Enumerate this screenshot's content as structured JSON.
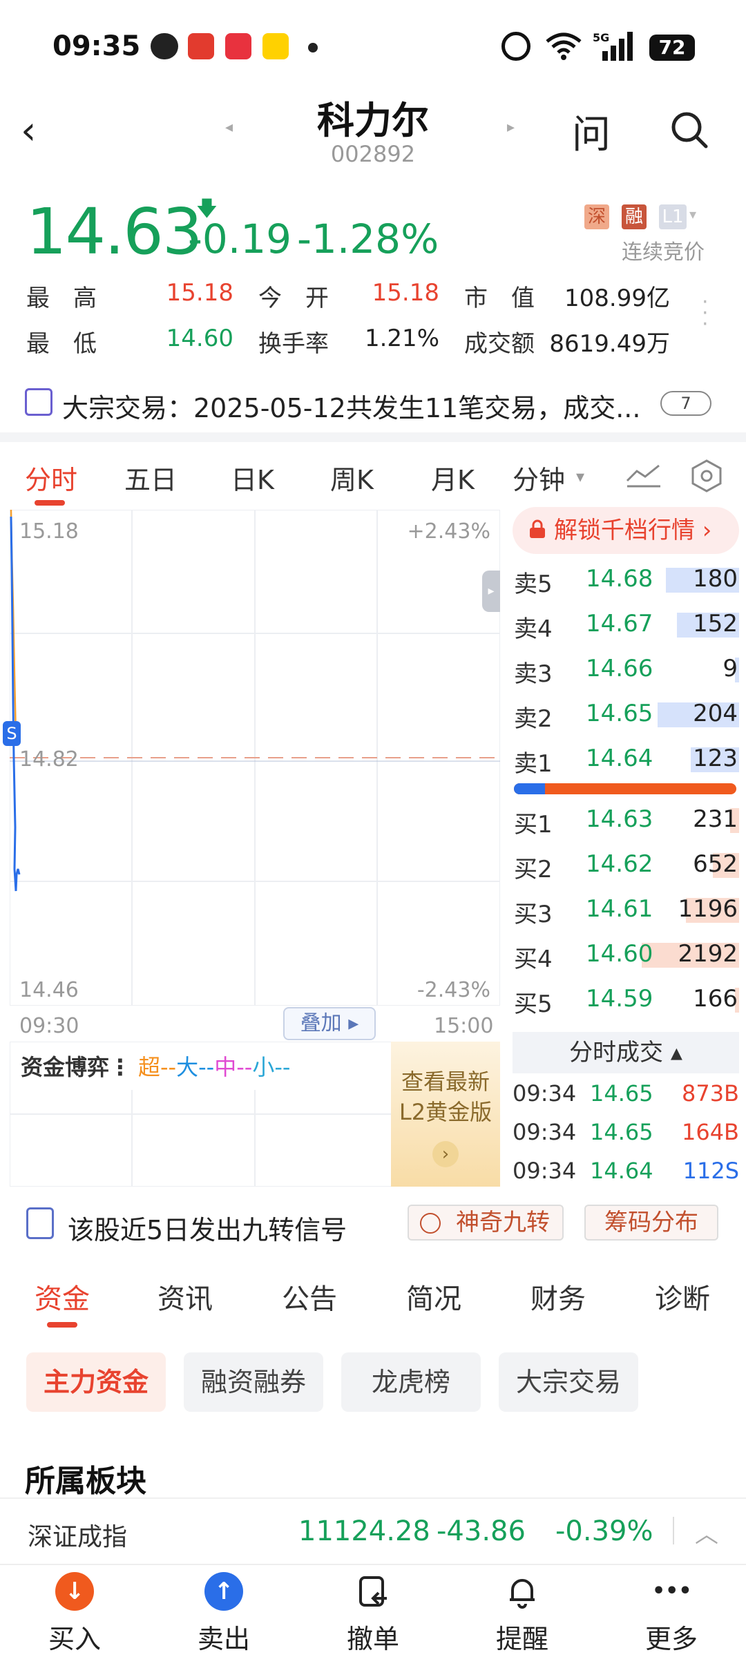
{
  "status_bar": {
    "time": "09:35",
    "battery": "72"
  },
  "header": {
    "name": "科力尔",
    "code": "002892",
    "ask": "问"
  },
  "quote": {
    "price": "14.63",
    "change": "-0.19",
    "change_pct": "-1.28%",
    "tags": [
      "深",
      "融",
      "L1"
    ],
    "auction": "连续竞价",
    "stats": [
      {
        "label": "最　高",
        "value": "15.18",
        "color": "red"
      },
      {
        "label": "今　开",
        "value": "15.18",
        "color": "red"
      },
      {
        "label": "市　值",
        "value": "108.99亿",
        "color": "black"
      },
      {
        "label": "最　低",
        "value": "14.60",
        "color": "green"
      },
      {
        "label": "换手率",
        "value": "1.21%",
        "color": "black"
      },
      {
        "label": "成交额",
        "value": "8619.49万",
        "color": "black"
      }
    ]
  },
  "block_trade": {
    "text": "大宗交易：2025-05-12共发生11笔交易，成交...",
    "count": "7"
  },
  "period_tabs": [
    "分时",
    "五日",
    "日K",
    "周K",
    "月K",
    "分钟"
  ],
  "chart": {
    "price_high": "15.18",
    "price_mid": "14.82",
    "price_low": "14.46",
    "pct_high": "+2.43%",
    "pct_low": "-2.43%",
    "time_start": "09:30",
    "time_end": "15:00",
    "overlay": "叠加",
    "marker": "S"
  },
  "capital": {
    "label": "资金博弈",
    "legend": [
      {
        "text": "超--",
        "color": "#f5901e"
      },
      {
        "text": "大--",
        "color": "#1e8fe0"
      },
      {
        "text": "中--",
        "color": "#e04ad2"
      },
      {
        "text": "小--",
        "color": "#2aa6d6"
      }
    ],
    "promo_line1": "查看最新",
    "promo_line2": "L2黄金版"
  },
  "order_book": {
    "unlock": "解锁千档行情",
    "asks": [
      {
        "label": "卖5",
        "price": "14.68",
        "volume": "180",
        "fill": 0.33
      },
      {
        "label": "卖4",
        "price": "14.67",
        "volume": "152",
        "fill": 0.28
      },
      {
        "label": "卖3",
        "price": "14.66",
        "volume": "9",
        "fill": 0.02
      },
      {
        "label": "卖2",
        "price": "14.65",
        "volume": "204",
        "fill": 0.37
      },
      {
        "label": "卖1",
        "price": "14.64",
        "volume": "123",
        "fill": 0.22
      }
    ],
    "bid_ratio": 0.14,
    "bids": [
      {
        "label": "买1",
        "price": "14.63",
        "volume": "231",
        "fill": 0.04
      },
      {
        "label": "买2",
        "price": "14.62",
        "volume": "652",
        "fill": 0.12
      },
      {
        "label": "买3",
        "price": "14.61",
        "volume": "1196",
        "fill": 0.24
      },
      {
        "label": "买4",
        "price": "14.60",
        "volume": "2192",
        "fill": 0.44
      },
      {
        "label": "买5",
        "price": "14.59",
        "volume": "166",
        "fill": 0.02
      }
    ],
    "trades_header": "分时成交",
    "trades": [
      {
        "time": "09:34",
        "price": "14.65",
        "volume": "873B",
        "color": "red"
      },
      {
        "time": "09:34",
        "price": "14.65",
        "volume": "164B",
        "color": "red"
      },
      {
        "time": "09:34",
        "price": "14.64",
        "volume": "112S",
        "color": "blue"
      }
    ]
  },
  "signal": {
    "text": "该股近5日发出九转信号",
    "nine_turn": "神奇九转",
    "chip": "筹码分布"
  },
  "info_tabs": [
    "资金",
    "资讯",
    "公告",
    "简况",
    "财务",
    "诊断"
  ],
  "sub_chips": [
    "主力资金",
    "融资融券",
    "龙虎榜",
    "大宗交易"
  ],
  "sector_title": "所属板块",
  "index": {
    "name": "深证成指",
    "value": "11124.28",
    "change": "-43.86",
    "pct": "-0.39%"
  },
  "bottom_nav": [
    {
      "label": "买入",
      "icon": "↓",
      "color": "#f05a1e"
    },
    {
      "label": "卖出",
      "icon": "↑",
      "color": "#2a6ee8"
    },
    {
      "label": "撤单",
      "icon": "",
      "color": ""
    },
    {
      "label": "提醒",
      "icon": "",
      "color": ""
    },
    {
      "label": "更多",
      "icon": "•••",
      "color": ""
    }
  ]
}
